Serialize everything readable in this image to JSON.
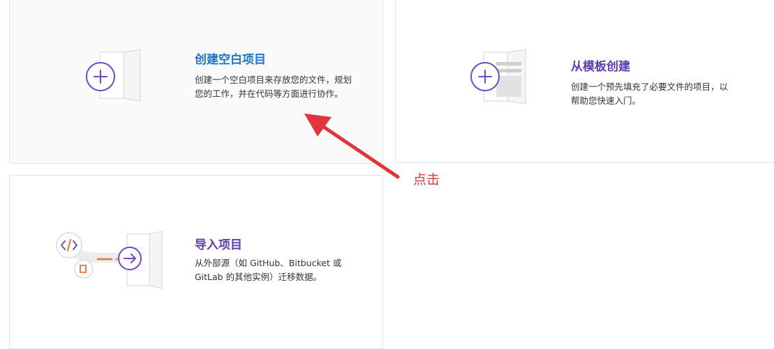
{
  "cards": {
    "blank_project": {
      "title": "创建空白项目",
      "description": "创建一个空白项目来存放您的文件，规划您的工作，并在代码等方面进行协作。"
    },
    "from_template": {
      "title": "从模板创建",
      "description": "创建一个预先填充了必要文件的项目，以帮助您快速入门。"
    },
    "import_project": {
      "title": "导入项目",
      "description": "从外部源（如 GitHub、Bitbucket 或 GitLab 的其他实例）迁移数据。"
    }
  },
  "annotation": {
    "text": "点击"
  },
  "icons": {
    "blank_project": "plus-document-icon",
    "from_template": "template-document-icon",
    "import_project": "import-code-icon"
  },
  "colors": {
    "accent_purple": "#6e49cb",
    "title_blue": "#1f75cb",
    "title_purple": "#5b3fb0",
    "annotation_red": "#e0353b",
    "hover_background": "#fafafa",
    "border": "#e3e3e3"
  }
}
